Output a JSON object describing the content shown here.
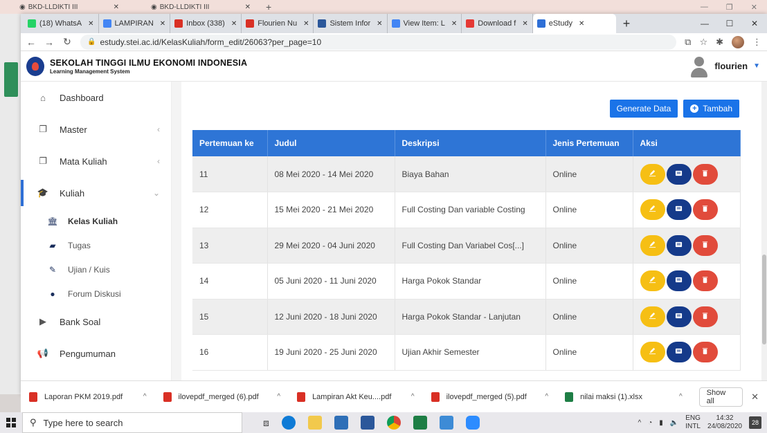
{
  "background_window": {
    "tabs": [
      {
        "label": "BKD-LLDIKTI III"
      },
      {
        "label": "BKD-LLDIKTI III"
      }
    ]
  },
  "browser": {
    "tabs": [
      {
        "label": "(18) WhatsA",
        "color": "#25d366"
      },
      {
        "label": "LAMPIRAN",
        "color": "#4285f4"
      },
      {
        "label": "Inbox (338)",
        "color": "#d93025"
      },
      {
        "label": "Flourien Nu",
        "color": "#d93025"
      },
      {
        "label": "Sistem Infor",
        "color": "#2b579a"
      },
      {
        "label": "View Item: L",
        "color": "#4285f4"
      },
      {
        "label": "Download f",
        "color": "#e53935"
      },
      {
        "label": "eStudy",
        "color": "#2e6fd6"
      }
    ],
    "url": "estudy.stei.ac.id/KelasKuliah/form_edit/26063?per_page=10"
  },
  "app": {
    "title": "SEKOLAH TINGGI ILMU EKONOMI INDONESIA",
    "subtitle": "Learning Management System",
    "user": "flourien"
  },
  "sidebar": {
    "items": [
      {
        "label": "Dashboard",
        "icon": "home-icon"
      },
      {
        "label": "Master",
        "icon": "copy-icon"
      },
      {
        "label": "Mata Kuliah",
        "icon": "copy-icon"
      },
      {
        "label": "Kuliah",
        "icon": "graduation-cap-icon"
      }
    ],
    "subitems": [
      {
        "label": "Kelas Kuliah",
        "icon": "bank-icon"
      },
      {
        "label": "Tugas",
        "icon": "book-icon"
      },
      {
        "label": "Ujian / Kuis",
        "icon": "pencil-icon"
      },
      {
        "label": "Forum Diskusi",
        "icon": "comments-icon"
      }
    ],
    "bottom_items": [
      {
        "label": "Bank Soal",
        "icon": "folder-icon"
      },
      {
        "label": "Pengumuman",
        "icon": "megaphone-icon"
      }
    ]
  },
  "toolbar": {
    "generate_label": "Generate Data",
    "tambah_label": "Tambah"
  },
  "table": {
    "headers": [
      "Pertemuan ke",
      "Judul",
      "Deskripsi",
      "Jenis Pertemuan",
      "Aksi"
    ],
    "rows": [
      {
        "no": "11",
        "judul": "08 Mei 2020 - 14 Mei 2020",
        "deskripsi": "Biaya Bahan",
        "jenis": "Online"
      },
      {
        "no": "12",
        "judul": "15 Mei 2020 - 21 Mei 2020",
        "deskripsi": "Full Costing Dan variable Costing",
        "jenis": "Online"
      },
      {
        "no": "13",
        "judul": "29 Mei 2020 - 04 Juni 2020",
        "deskripsi": "Full Costing Dan Variabel Cos[...]",
        "jenis": "Online"
      },
      {
        "no": "14",
        "judul": "05 Juni 2020 - 11 Juni 2020",
        "deskripsi": "Harga Pokok Standar",
        "jenis": "Online"
      },
      {
        "no": "15",
        "judul": "12 Juni 2020 - 18 Juni 2020",
        "deskripsi": "Harga Pokok Standar - Lanjutan",
        "jenis": "Online"
      },
      {
        "no": "16",
        "judul": "19 Juni 2020 - 25 Juni 2020",
        "deskripsi": "Ujian Akhir Semester",
        "jenis": "Online"
      }
    ]
  },
  "downloads": {
    "items": [
      {
        "name": "Laporan PKM 2019.pdf",
        "type": "pdf"
      },
      {
        "name": "ilovepdf_merged (6).pdf",
        "type": "pdf"
      },
      {
        "name": "Lampiran Akt Keu....pdf",
        "type": "pdf"
      },
      {
        "name": "ilovepdf_merged (5).pdf",
        "type": "pdf"
      },
      {
        "name": "nilai maksi (1).xlsx",
        "type": "xlsx"
      }
    ],
    "show_all": "Show all"
  },
  "taskbar": {
    "search_placeholder": "Type here to search",
    "lang_line1": "ENG",
    "lang_line2": "INTL",
    "time": "14:32",
    "date": "24/08/2020",
    "notifications": "28"
  },
  "colors": {
    "accent": "#2e75d6",
    "edit": "#f6bf14",
    "detail": "#153a8a",
    "delete": "#e14b3b"
  }
}
